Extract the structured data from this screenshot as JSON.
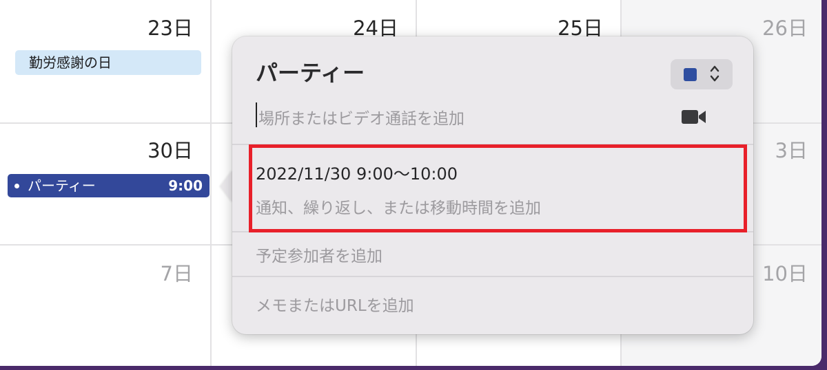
{
  "calendar": {
    "days": {
      "d23": "23日",
      "d24": "24日",
      "d25": "25日",
      "d26": "26日",
      "d30": "30日",
      "d3": "3日",
      "d7": "7日",
      "d10": "10日"
    },
    "holiday": "勤労感謝の日",
    "event": {
      "title": "パーティー",
      "time": "9:00",
      "color": "#33489a"
    }
  },
  "popover": {
    "title": "パーティー",
    "color": "#2f4ea0",
    "location_placeholder": "場所またはビデオ通話を追加",
    "datetime": "2022/11/30 9:00～10:00",
    "alerts_placeholder": "通知、繰り返し、または移動時間を追加",
    "invitees_placeholder": "予定参加者を追加",
    "notes_placeholder": "メモまたはURLを追加",
    "icons": {
      "video": "video-camera-icon",
      "stepper": "chevron-up-down-icon"
    }
  },
  "highlight_color": "#e8202a"
}
